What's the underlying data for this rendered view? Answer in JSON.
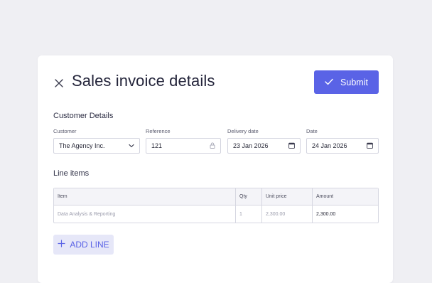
{
  "header": {
    "title": "Sales invoice details",
    "submit_label": "Submit"
  },
  "customer_section": {
    "title": "Customer Details",
    "fields": {
      "customer": {
        "label": "Customer",
        "value": "The Agency Inc."
      },
      "reference": {
        "label": "Reference",
        "value": "121"
      },
      "delivery_date": {
        "label": "Delivery date",
        "value": "23 Jan 2026"
      },
      "date": {
        "label": "Date",
        "value": "24 Jan 2026"
      }
    }
  },
  "line_items": {
    "title": "Line items",
    "columns": [
      "Item",
      "Qty",
      "Unit price",
      "Amount"
    ],
    "rows": [
      {
        "item": "Data Analysis & Reporting",
        "qty": "1",
        "unit_price": "2,300.00",
        "amount": "2,300.00"
      }
    ],
    "add_label": "ADD LINE"
  },
  "colors": {
    "accent": "#5a63e6",
    "background": "#efeff3",
    "add_button_bg": "#e6e7f8"
  },
  "icons": [
    "close-icon",
    "check-icon",
    "chevron-down-icon",
    "lock-icon",
    "calendar-icon",
    "plus-icon"
  ]
}
